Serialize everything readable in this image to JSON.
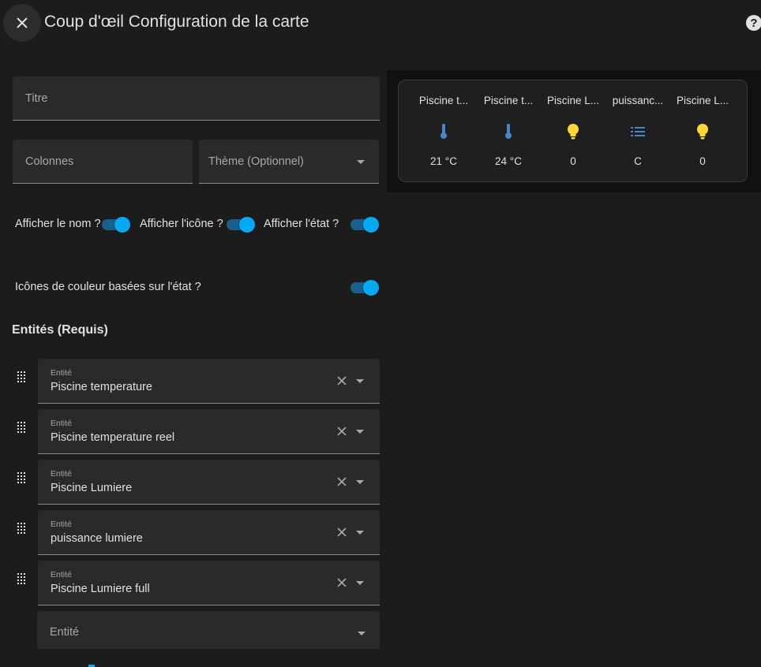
{
  "header": {
    "title": "Coup d'œil Configuration de la carte",
    "help_glyph": "?"
  },
  "form": {
    "title_label": "Titre",
    "columns_label": "Colonnes",
    "theme_label": "Thème (Optionnel)",
    "show_name_label": "Afficher le nom ?",
    "show_name": true,
    "show_icon_label": "Afficher l'icône ?",
    "show_icon": true,
    "show_state_label": "Afficher l'état ?",
    "show_state": true,
    "state_color_label": "Icônes de couleur basées sur l'état ?",
    "state_color": true
  },
  "entities_section": {
    "title": "Entités (Requis)",
    "field_label": "Entité",
    "items": [
      {
        "value": "Piscine temperature"
      },
      {
        "value": "Piscine temperature reel"
      },
      {
        "value": "Piscine Lumiere"
      },
      {
        "value": "puissance lumiere"
      },
      {
        "value": "Piscine Lumiere full"
      }
    ],
    "new_entity_label": "Entité"
  },
  "preview": {
    "items": [
      {
        "name": "Piscine t...",
        "icon": "thermometer-icon",
        "state": "21 °C",
        "color": "#4a86c8"
      },
      {
        "name": "Piscine t...",
        "icon": "thermometer-icon",
        "state": "24 °C",
        "color": "#4a86c8"
      },
      {
        "name": "Piscine L...",
        "icon": "lightbulb-icon",
        "state": "0",
        "color": "#fdd835"
      },
      {
        "name": "puissanc...",
        "icon": "format-list-icon",
        "state": "C",
        "color": "#4a86c8"
      },
      {
        "name": "Piscine L...",
        "icon": "lightbulb-icon",
        "state": "0",
        "color": "#fdd835"
      }
    ]
  },
  "colors": {
    "accent": "#03a9f4",
    "background": "#1c1c1c",
    "field_bg": "#2a2a2a"
  }
}
